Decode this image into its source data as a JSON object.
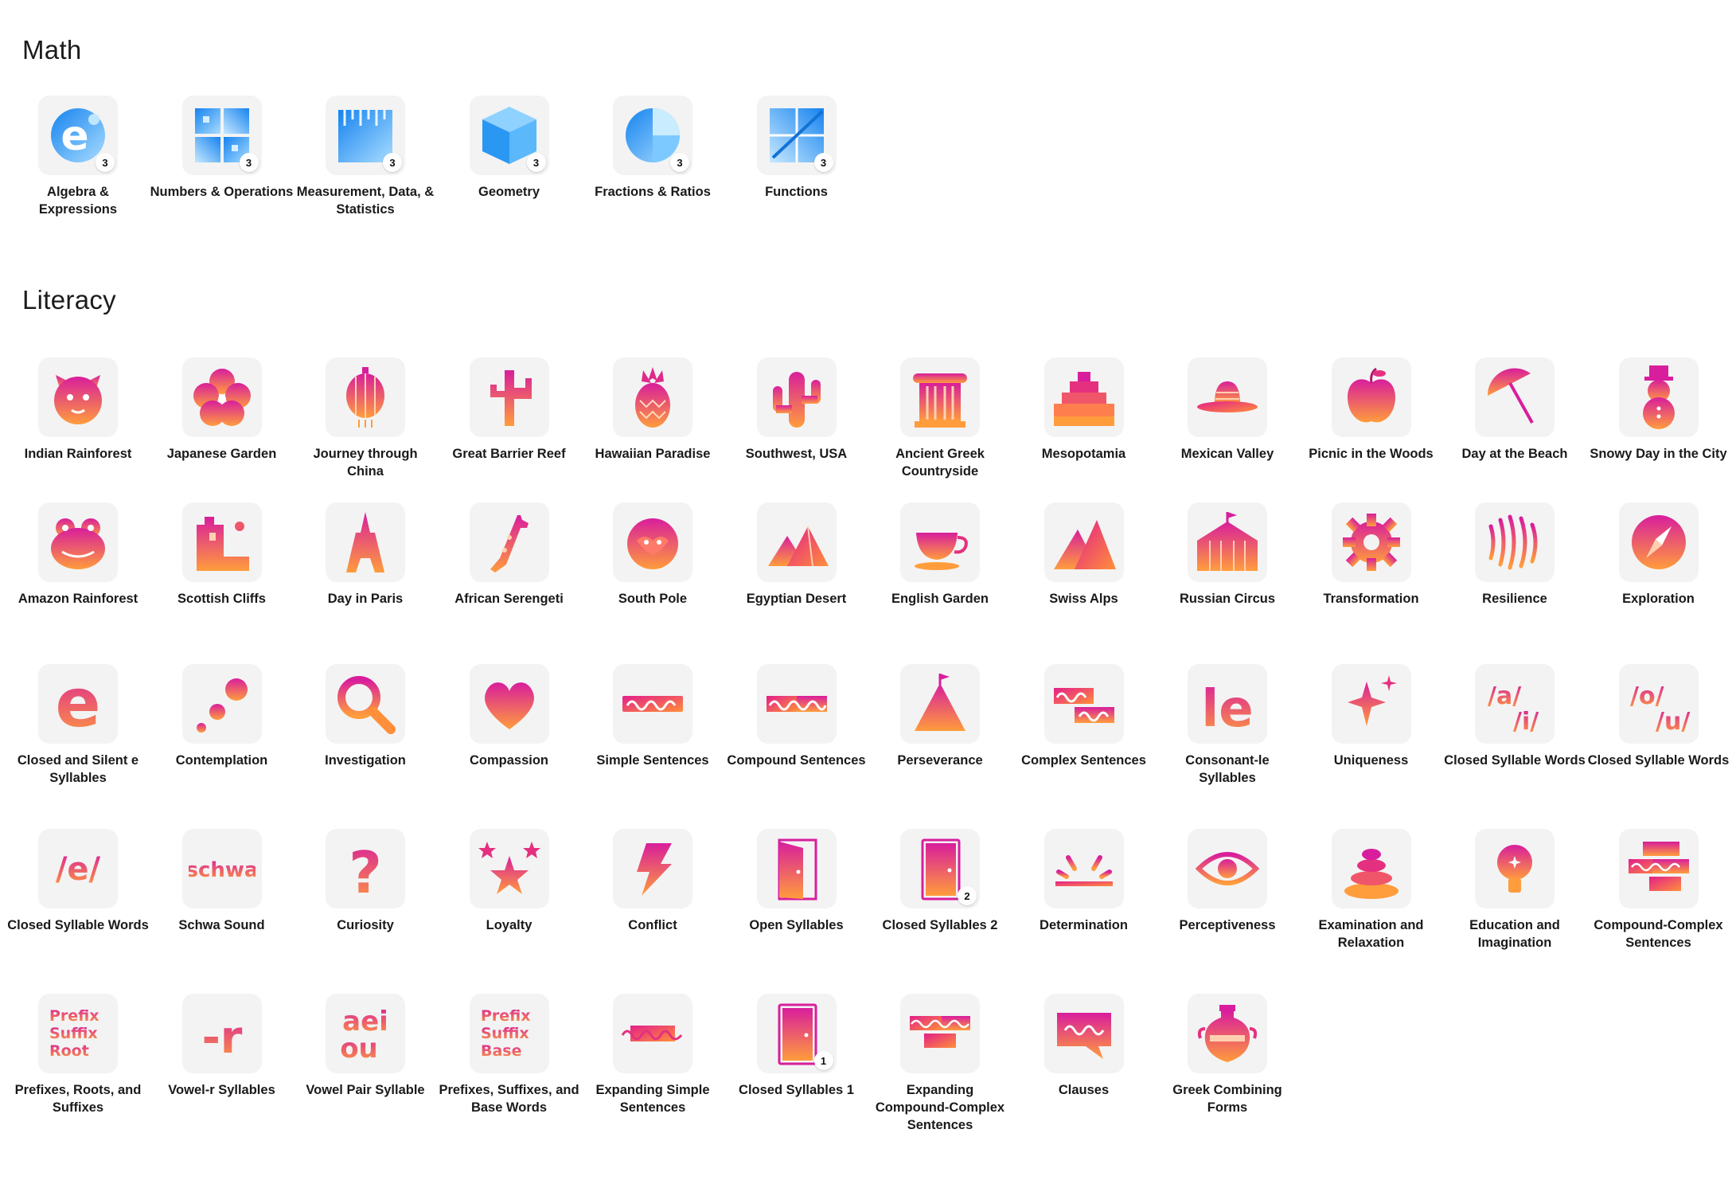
{
  "sections": {
    "math": {
      "title": "Math",
      "items": [
        {
          "label": "Algebra & Expressions",
          "icon": "algebra-icon",
          "badge": "3"
        },
        {
          "label": "Numbers & Operations",
          "icon": "numbers-icon",
          "badge": "3"
        },
        {
          "label": "Measurement, Data, & Statistics",
          "icon": "measurement-icon",
          "badge": "3"
        },
        {
          "label": "Geometry",
          "icon": "cube-icon",
          "badge": "3"
        },
        {
          "label": "Fractions & Ratios",
          "icon": "pie-fraction-icon",
          "badge": "3"
        },
        {
          "label": "Functions",
          "icon": "functions-graph-icon",
          "badge": "3"
        }
      ]
    },
    "literacy": {
      "title": "Literacy",
      "items": [
        {
          "label": "Indian Rainforest",
          "icon": "tiger-icon"
        },
        {
          "label": "Japanese Garden",
          "icon": "sakura-flower-icon"
        },
        {
          "label": "Journey through China",
          "icon": "lantern-icon"
        },
        {
          "label": "Great Barrier Reef",
          "icon": "coral-icon"
        },
        {
          "label": "Hawaiian Paradise",
          "icon": "pineapple-icon"
        },
        {
          "label": "Southwest, USA",
          "icon": "cactus-icon"
        },
        {
          "label": "Ancient Greek Countryside",
          "icon": "column-icon"
        },
        {
          "label": "Mesopotamia",
          "icon": "ziggurat-icon"
        },
        {
          "label": "Mexican Valley",
          "icon": "sombrero-icon"
        },
        {
          "label": "Picnic in the Woods",
          "icon": "apple-icon"
        },
        {
          "label": "Day at the Beach",
          "icon": "umbrella-icon"
        },
        {
          "label": "Snowy Day in the City",
          "icon": "snowman-icon"
        },
        {
          "label": "Amazon Rainforest",
          "icon": "frog-icon"
        },
        {
          "label": "Scottish Cliffs",
          "icon": "castle-cliff-icon"
        },
        {
          "label": "Day in Paris",
          "icon": "eiffel-tower-icon"
        },
        {
          "label": "African Serengeti",
          "icon": "giraffe-icon"
        },
        {
          "label": "South Pole",
          "icon": "penguin-icon"
        },
        {
          "label": "Egyptian Desert",
          "icon": "pyramids-icon"
        },
        {
          "label": "English Garden",
          "icon": "teacup-icon"
        },
        {
          "label": "Swiss Alps",
          "icon": "mountains-icon"
        },
        {
          "label": "Russian Circus",
          "icon": "circus-tent-icon"
        },
        {
          "label": "Transformation",
          "icon": "gear-icon"
        },
        {
          "label": "Resilience",
          "icon": "waves-icon"
        },
        {
          "label": "Exploration",
          "icon": "compass-icon"
        },
        {
          "label": "Closed and Silent e Syllables",
          "icon": "letter-e-icon"
        },
        {
          "label": "Contemplation",
          "icon": "dots-icon"
        },
        {
          "label": "Investigation",
          "icon": "magnifier-icon"
        },
        {
          "label": "Compassion",
          "icon": "heart-icon"
        },
        {
          "label": "Simple Sentences",
          "icon": "sentence-bar-icon"
        },
        {
          "label": "Compound Sentences",
          "icon": "compound-sentence-icon"
        },
        {
          "label": "Perseverance",
          "icon": "mountain-flag-icon"
        },
        {
          "label": "Complex Sentences",
          "icon": "complex-sentence-icon"
        },
        {
          "label": "Consonant-le Syllables",
          "icon": "letters-le-icon"
        },
        {
          "label": "Uniqueness",
          "icon": "sparkle-icon"
        },
        {
          "label": "Closed Syllable Words",
          "icon": "phoneme-a-i-icon"
        },
        {
          "label": "Closed Syllable Words",
          "icon": "phoneme-o-u-icon"
        },
        {
          "label": "Closed Syllable Words",
          "icon": "phoneme-e-icon"
        },
        {
          "label": "Schwa Sound",
          "icon": "schwa-text-icon"
        },
        {
          "label": "Curiosity",
          "icon": "question-mark-icon"
        },
        {
          "label": "Loyalty",
          "icon": "stars-icon"
        },
        {
          "label": "Conflict",
          "icon": "lightning-icon"
        },
        {
          "label": "Open Syllables",
          "icon": "open-door-icon"
        },
        {
          "label": "Closed Syllables 2",
          "icon": "closed-door-icon",
          "badge": "2"
        },
        {
          "label": "Determination",
          "icon": "sunrise-icon"
        },
        {
          "label": "Perceptiveness",
          "icon": "eye-icon"
        },
        {
          "label": "Examination and Relaxation",
          "icon": "stacked-stones-icon"
        },
        {
          "label": "Education and Imagination",
          "icon": "lightbulb-icon"
        },
        {
          "label": "Compound-Complex Sentences",
          "icon": "compound-complex-sentence-icon"
        },
        {
          "label": "Prefixes, Roots, and Suffixes",
          "icon": "prefix-suffix-root-icon"
        },
        {
          "label": "Vowel-r Syllables",
          "icon": "letter-r-icon"
        },
        {
          "label": "Vowel Pair Syllable",
          "icon": "aei-ou-icon"
        },
        {
          "label": "Prefixes, Suffixes, and Base Words",
          "icon": "prefix-suffix-base-icon"
        },
        {
          "label": "Expanding Simple Sentences",
          "icon": "expanding-sentence-icon"
        },
        {
          "label": "Closed Syllables 1",
          "icon": "closed-door-icon",
          "badge": "1"
        },
        {
          "label": "Expanding Compound-Complex Sentences",
          "icon": "expanding-compound-icon"
        },
        {
          "label": "Clauses",
          "icon": "speech-bubble-icon"
        },
        {
          "label": "Greek Combining Forms",
          "icon": "greek-vase-icon"
        }
      ]
    }
  },
  "icon_text": {
    "phoneme_a": "/a/",
    "phoneme_i": "/i/",
    "phoneme_o": "/o/",
    "phoneme_u": "/u/",
    "phoneme_e": "/e/",
    "schwa": "schwa",
    "letter_e": "e",
    "letters_le": "le",
    "letter_r": "-r",
    "question": "?",
    "aei": "aei",
    "ou": "ou",
    "prefix": "Prefix",
    "suffix": "Suffix",
    "root": "Root",
    "base": "Base"
  },
  "colors": {
    "math_gradient": [
      "#1b8cf2",
      "#9fd8ff"
    ],
    "literacy_gradient": [
      "#d8209a",
      "#ff9a3e"
    ],
    "tile_background": "#f3f3f3",
    "badge_background": "#ffffff"
  }
}
